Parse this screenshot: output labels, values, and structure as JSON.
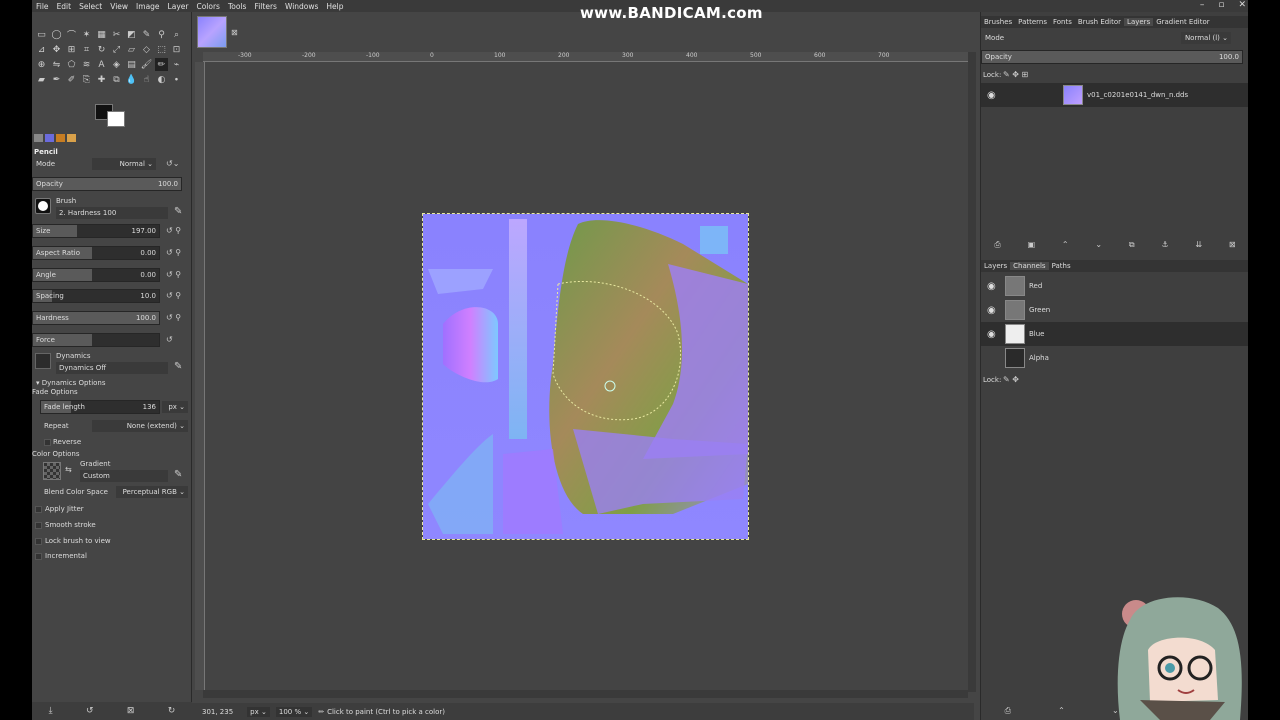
{
  "watermark": "www.BANDICAM.com",
  "menu": [
    "File",
    "Edit",
    "Select",
    "View",
    "Image",
    "Layer",
    "Colors",
    "Tools",
    "Filters",
    "Windows",
    "Help"
  ],
  "tool_options": {
    "title": "Pencil",
    "mode_label": "Mode",
    "mode_value": "Normal",
    "opacity_label": "Opacity",
    "opacity_value": "100.0",
    "brush_label": "Brush",
    "brush_value": "2. Hardness 100",
    "size_label": "Size",
    "size_value": "197.00",
    "aspect_label": "Aspect Ratio",
    "aspect_value": "0.00",
    "angle_label": "Angle",
    "angle_value": "0.00",
    "spacing_label": "Spacing",
    "spacing_value": "10.0",
    "hardness_label": "Hardness",
    "hardness_value": "100.0",
    "force_label": "Force",
    "dynamics_label": "Dynamics",
    "dynamics_value": "Dynamics Off",
    "dynamics_options": "Dynamics Options",
    "fade_options": "Fade Options",
    "fade_length_label": "Fade length",
    "fade_length_value": "136",
    "fade_unit": "px",
    "repeat_label": "Repeat",
    "repeat_value": "None (extend)",
    "reverse_label": "Reverse",
    "color_options": "Color Options",
    "gradient_label": "Gradient",
    "gradient_value": "Custom",
    "blend_label": "Blend Color Space",
    "blend_value": "Perceptual RGB",
    "apply_jitter": "Apply Jitter",
    "smooth_stroke": "Smooth stroke",
    "lock_brush": "Lock brush to view",
    "incremental": "Incremental"
  },
  "ruler_labels": [
    "-300",
    "-200",
    "-100",
    "0",
    "100",
    "200",
    "300",
    "400",
    "500",
    "600",
    "700"
  ],
  "status": {
    "coords": "301, 235",
    "unit": "px",
    "zoom": "100 %",
    "message": "Click to paint (Ctrl to pick a color)"
  },
  "top_dock": {
    "tabs": [
      "Brushes",
      "Patterns",
      "Fonts",
      "Brush Editor",
      "Layers",
      "Gradient Editor"
    ],
    "mode_label": "Mode",
    "mode_value": "Normal (l)",
    "opacity_label": "Opacity",
    "opacity_value": "100.0",
    "lock_label": "Lock:",
    "layer_name": "v01_c0201e0141_dwn_n.dds"
  },
  "bottom_dock": {
    "tabs": [
      "Layers",
      "Channels",
      "Paths"
    ],
    "channels": [
      "Red",
      "Green",
      "Blue",
      "Alpha"
    ],
    "lock_label": "Lock:"
  },
  "colors": {
    "accent": "#8a82fe",
    "ui_bg": "#454545",
    "dock_bg": "#3f3f3f"
  }
}
